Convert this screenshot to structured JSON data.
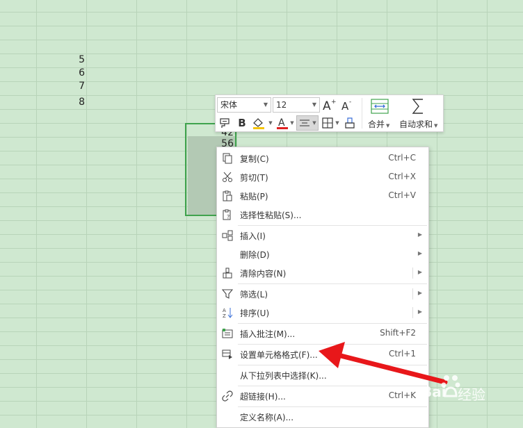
{
  "sheet": {
    "row_numbers": [
      "5",
      "6",
      "7",
      "8"
    ],
    "selection_values": [
      "42",
      "56"
    ]
  },
  "toolbar": {
    "font_name": "宋体",
    "font_size": "12",
    "merge_label": "合并",
    "autosum_label": "自动求和"
  },
  "menu": {
    "items": [
      {
        "label": "复制(C)",
        "shortcut": "Ctrl+C"
      },
      {
        "label": "剪切(T)",
        "shortcut": "Ctrl+X"
      },
      {
        "label": "粘贴(P)",
        "shortcut": "Ctrl+V"
      },
      {
        "label": "选择性粘贴(S)...",
        "shortcut": ""
      },
      {
        "label": "插入(I)",
        "shortcut": ""
      },
      {
        "label": "删除(D)",
        "shortcut": ""
      },
      {
        "label": "清除内容(N)",
        "shortcut": ""
      },
      {
        "label": "筛选(L)",
        "shortcut": ""
      },
      {
        "label": "排序(U)",
        "shortcut": ""
      },
      {
        "label": "插入批注(M)...",
        "shortcut": "Shift+F2"
      },
      {
        "label": "设置单元格格式(F)...",
        "shortcut": "Ctrl+1"
      },
      {
        "label": "从下拉列表中选择(K)...",
        "shortcut": ""
      },
      {
        "label": "超链接(H)...",
        "shortcut": "Ctrl+K"
      },
      {
        "label": "定义名称(A)...",
        "shortcut": ""
      }
    ]
  },
  "watermark": {
    "brand": "Bai",
    "brand_suffix": "经验"
  },
  "colors": {
    "sheet_bg": "#cfe8d0",
    "selection_border": "#3fa34d",
    "arrow": "#e8171a",
    "font_color_underline": "#e02020",
    "highlight_color": "#f5c400"
  }
}
